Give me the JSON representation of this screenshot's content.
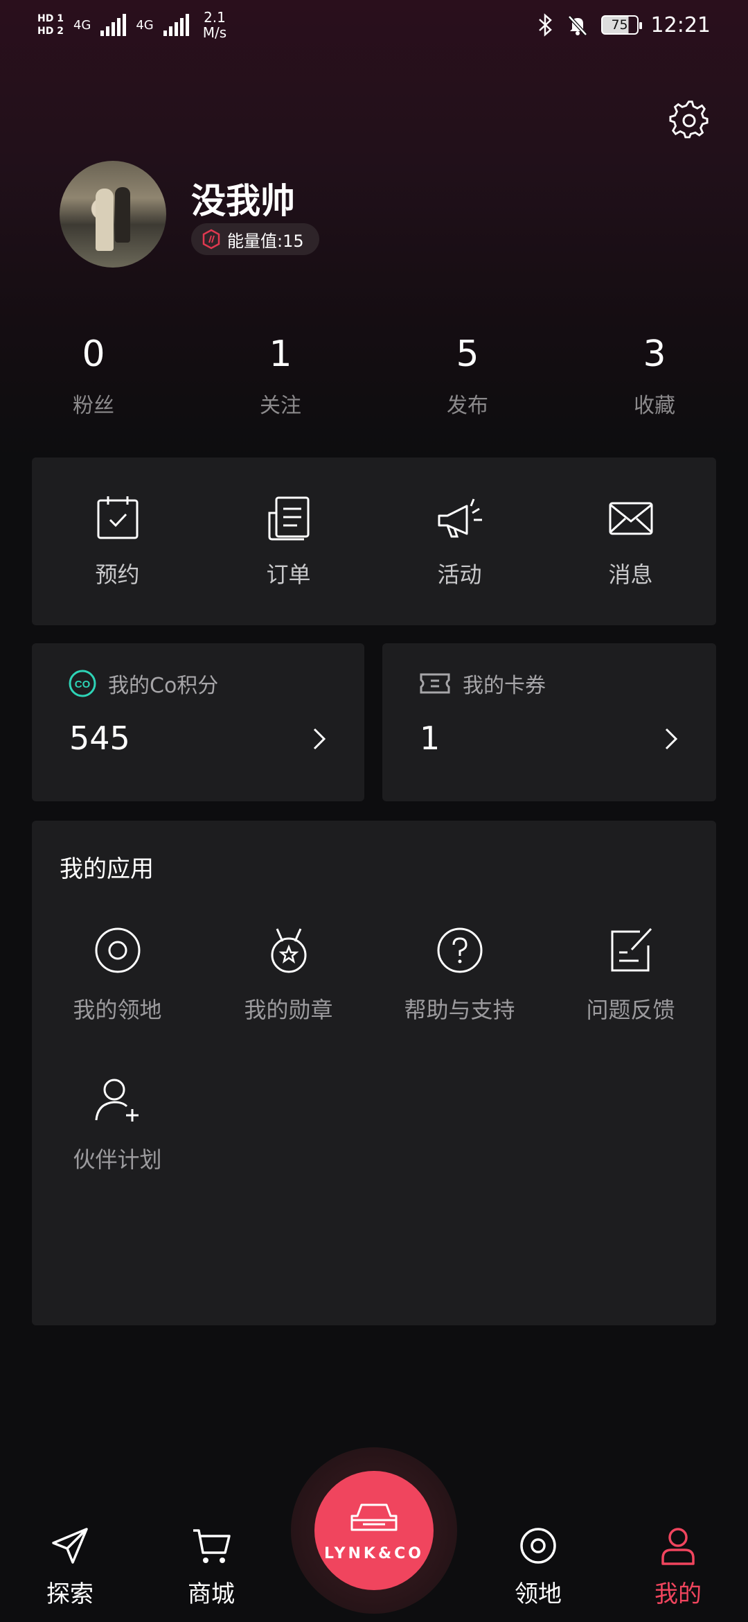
{
  "status_bar": {
    "hd1": "HD 1",
    "hd2": "HD 2",
    "net1": "4G",
    "net2": "4G",
    "speed_value": "2.1",
    "speed_unit": "M/s",
    "battery": "75",
    "time": "12:21"
  },
  "profile": {
    "username": "没我帅",
    "energy_label": "能量值:15"
  },
  "stats": [
    {
      "value": "0",
      "label": "粉丝"
    },
    {
      "value": "1",
      "label": "关注"
    },
    {
      "value": "5",
      "label": "发布"
    },
    {
      "value": "3",
      "label": "收藏"
    }
  ],
  "quick_actions": [
    {
      "label": "预约",
      "icon": "calendar-check-icon"
    },
    {
      "label": "订单",
      "icon": "document-icon"
    },
    {
      "label": "活动",
      "icon": "megaphone-icon"
    },
    {
      "label": "消息",
      "icon": "envelope-icon"
    }
  ],
  "points": {
    "label": "我的Co积分",
    "value": "545",
    "icon_text": "CO"
  },
  "coupons": {
    "label": "我的卡券",
    "value": "1"
  },
  "apps": {
    "title": "我的应用",
    "items": [
      {
        "label": "我的领地",
        "icon": "territory-icon"
      },
      {
        "label": "我的勋章",
        "icon": "medal-icon"
      },
      {
        "label": "帮助与支持",
        "icon": "help-icon"
      },
      {
        "label": "问题反馈",
        "icon": "feedback-icon"
      },
      {
        "label": "伙伴计划",
        "icon": "add-user-icon"
      }
    ]
  },
  "tabbar": {
    "items": [
      {
        "label": "探索",
        "icon": "send-icon"
      },
      {
        "label": "商城",
        "icon": "cart-icon"
      },
      {
        "label": "领地",
        "icon": "territory-icon"
      },
      {
        "label": "我的",
        "icon": "user-icon"
      }
    ],
    "center_logo": "LYNK&CO",
    "active_color": "#f0455e"
  },
  "colors": {
    "accent": "#f0455e",
    "card_bg": "#1d1d1f",
    "points_icon": "#2ed3b6"
  }
}
